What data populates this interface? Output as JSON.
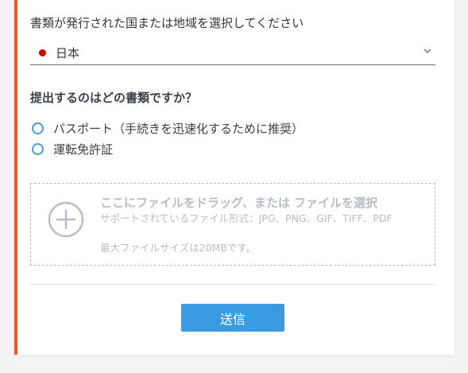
{
  "country": {
    "label": "書類が発行された国または地域を選択してください",
    "selected": "日本",
    "flag_color": "#d40000"
  },
  "document": {
    "question": "提出するのはどの書類ですか？",
    "options": [
      {
        "label": "パスポート（手続きを迅速化するために推奨）"
      },
      {
        "label": "運転免許証"
      }
    ]
  },
  "upload": {
    "title": "ここにファイルをドラッグ、または ファイルを選択",
    "formats": "サポートされているファイル形式：JPG、PNG、GIF、TIFF、PDF",
    "max_size": "最大ファイルサイズは20MBです。",
    "icon": "plus-circle-icon"
  },
  "submit": {
    "label": "送信",
    "color": "#3a9be0"
  },
  "accent_color": "#f4511e"
}
